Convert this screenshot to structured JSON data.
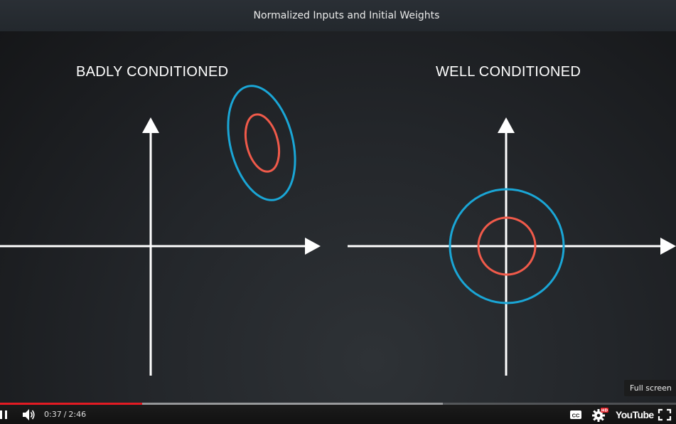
{
  "window": {
    "title": "Normalized Inputs and Initial Weights"
  },
  "slide": {
    "left_heading": "BADLY CONDITIONED",
    "right_heading": "WELL CONDITIONED",
    "colors": {
      "background": "#202326",
      "axis": "#ffffff",
      "outer_contour": "#1aa6d6",
      "inner_contour": "#f05a4a"
    }
  },
  "player": {
    "current_time": "0:37",
    "separator": "/",
    "duration": "2:46",
    "played_fraction": 0.21,
    "buffered_fraction": 0.655,
    "tooltip": "Full screen",
    "logo_text": "YouTube",
    "hd_badge": "HD",
    "accent_color": "#e31b23",
    "icons": {
      "play_pause": "pause-icon",
      "volume": "volume-icon",
      "captions": "captions-icon",
      "settings": "settings-icon",
      "fullscreen": "fullscreen-icon"
    }
  }
}
